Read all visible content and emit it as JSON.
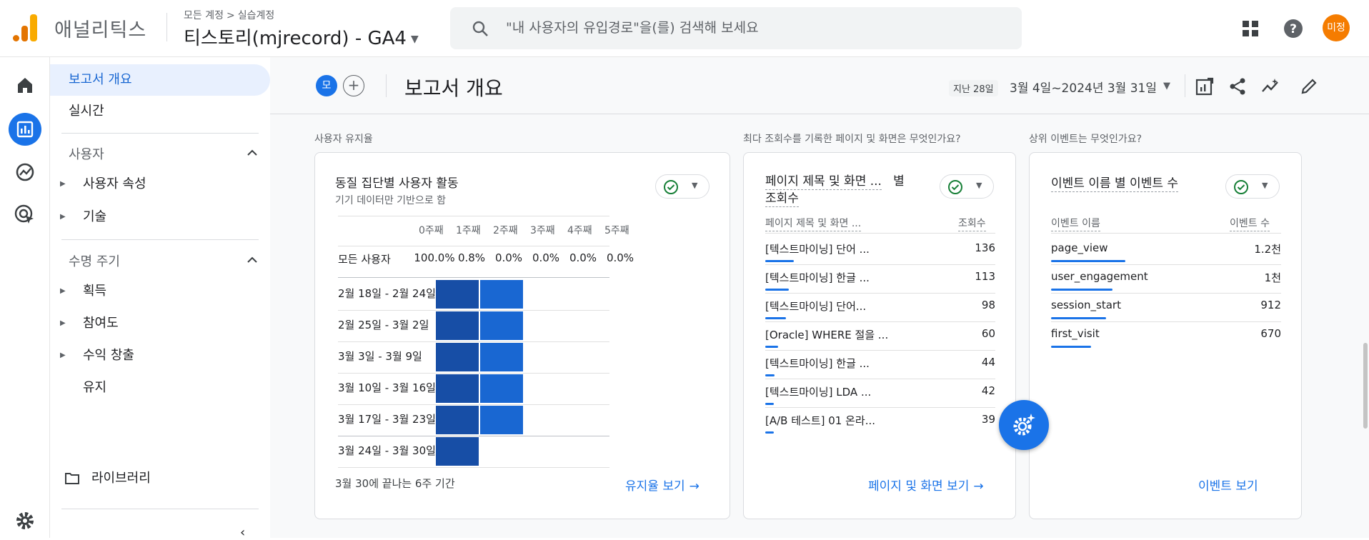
{
  "header": {
    "brand": "애널리틱스",
    "breadcrumb_root": "모든 계정",
    "breadcrumb_sep": ">",
    "breadcrumb_child": "실습계정",
    "property": "티스토리(mjrecord) - GA4",
    "search_placeholder": "\"내 사용자의 유입경로\"을(를) 검색해 보세요",
    "avatar_initials": "미정",
    "logo_colors": [
      "#f9ab00",
      "#e37400"
    ]
  },
  "sidebar": {
    "items": [
      {
        "label": "보고서 개요"
      },
      {
        "label": "실시간"
      }
    ],
    "sections": [
      {
        "label": "사용자",
        "children": [
          "사용자 속성",
          "기술"
        ]
      },
      {
        "label": "수명 주기",
        "children": [
          "획득",
          "참여도",
          "수익 창출",
          "유지"
        ]
      }
    ],
    "library_label": "라이브러리",
    "collapse_glyph": "‹"
  },
  "subheader": {
    "chip_label": "모",
    "add_glyph": "+",
    "title": "보고서 개요",
    "date_chip": "지난 28일",
    "date_range": "3월 4일~2024년 3월 31일",
    "date_caret": "▼"
  },
  "retention": {
    "section_label": "사용자 유지율",
    "card_title": "동질 집단별 사용자 활동",
    "card_subtitle": "기기 데이터만 기반으로 함",
    "columns": [
      "0주째",
      "1주째",
      "2주째",
      "3주째",
      "4주째",
      "5주째"
    ],
    "all_users_label": "모든 사용자",
    "all_users_values": [
      "100.0%",
      "0.8%",
      "0.0%",
      "0.0%",
      "0.0%",
      "0.0%"
    ],
    "cohort_rows": [
      {
        "label": "2월 18일 - 2월 24일",
        "w0": 1.0,
        "w1": 0.8
      },
      {
        "label": "2월 25일 - 3월 2일",
        "w0": 1.0,
        "w1": 0.8
      },
      {
        "label": "3월 3일 - 3월 9일",
        "w0": 1.0,
        "w1": 0.8
      },
      {
        "label": "3월 10일 - 3월 16일",
        "w0": 1.0,
        "w1": 0.8
      },
      {
        "label": "3월 17일 - 3월 23일",
        "w0": 1.0,
        "w1": 0.8
      },
      {
        "label": "3월 24일 - 3월 30일",
        "w0": 1.0,
        "w1": null
      }
    ],
    "footnote": "3월 30에 끝나는 6주 기간",
    "link": "유지율 보기",
    "colors": {
      "week0": "#174ea6",
      "week1": "#1967d2"
    }
  },
  "pages": {
    "section_label": "최다 조회수를 기록한 페이지 및 화면은 무엇인가요?",
    "card_title_a": "페이지 제목 및 화면 ...",
    "card_title_b": "별",
    "card_title_c": "조회수",
    "col_name": "페이지 제목 및 화면 ...",
    "col_value": "조회수",
    "rows": [
      {
        "name": "[텍스트마이닝] 단어 ...",
        "value": "136",
        "ratio": 1.0
      },
      {
        "name": "[텍스트마이닝] 한글 ...",
        "value": "113",
        "ratio": 0.83
      },
      {
        "name": "[텍스트마이닝] 단어...",
        "value": "98",
        "ratio": 0.72
      },
      {
        "name": "[Oracle] WHERE 절을 ...",
        "value": "60",
        "ratio": 0.44
      },
      {
        "name": "[텍스트마이닝] 한글 ...",
        "value": "44",
        "ratio": 0.32
      },
      {
        "name": "[텍스트마이닝] LDA ...",
        "value": "42",
        "ratio": 0.31
      },
      {
        "name": "[A/B 테스트] 01 온라...",
        "value": "39",
        "ratio": 0.29
      }
    ],
    "link": "페이지 및 화면 보기"
  },
  "events": {
    "section_label": "상위 이벤트는 무엇인가요?",
    "card_title": "이벤트 이름 별 이벤트 수",
    "col_name": "이벤트 이름",
    "col_value": "이벤트 수",
    "rows": [
      {
        "name": "page_view",
        "value": "1.2천",
        "ratio": 1.0
      },
      {
        "name": "user_engagement",
        "value": "1천",
        "ratio": 0.83
      },
      {
        "name": "session_start",
        "value": "912",
        "ratio": 0.74
      },
      {
        "name": "first_visit",
        "value": "670",
        "ratio": 0.54
      }
    ],
    "link": "이벤트 보기"
  },
  "arrow_glyph": "→",
  "caret_glyph": "▼"
}
